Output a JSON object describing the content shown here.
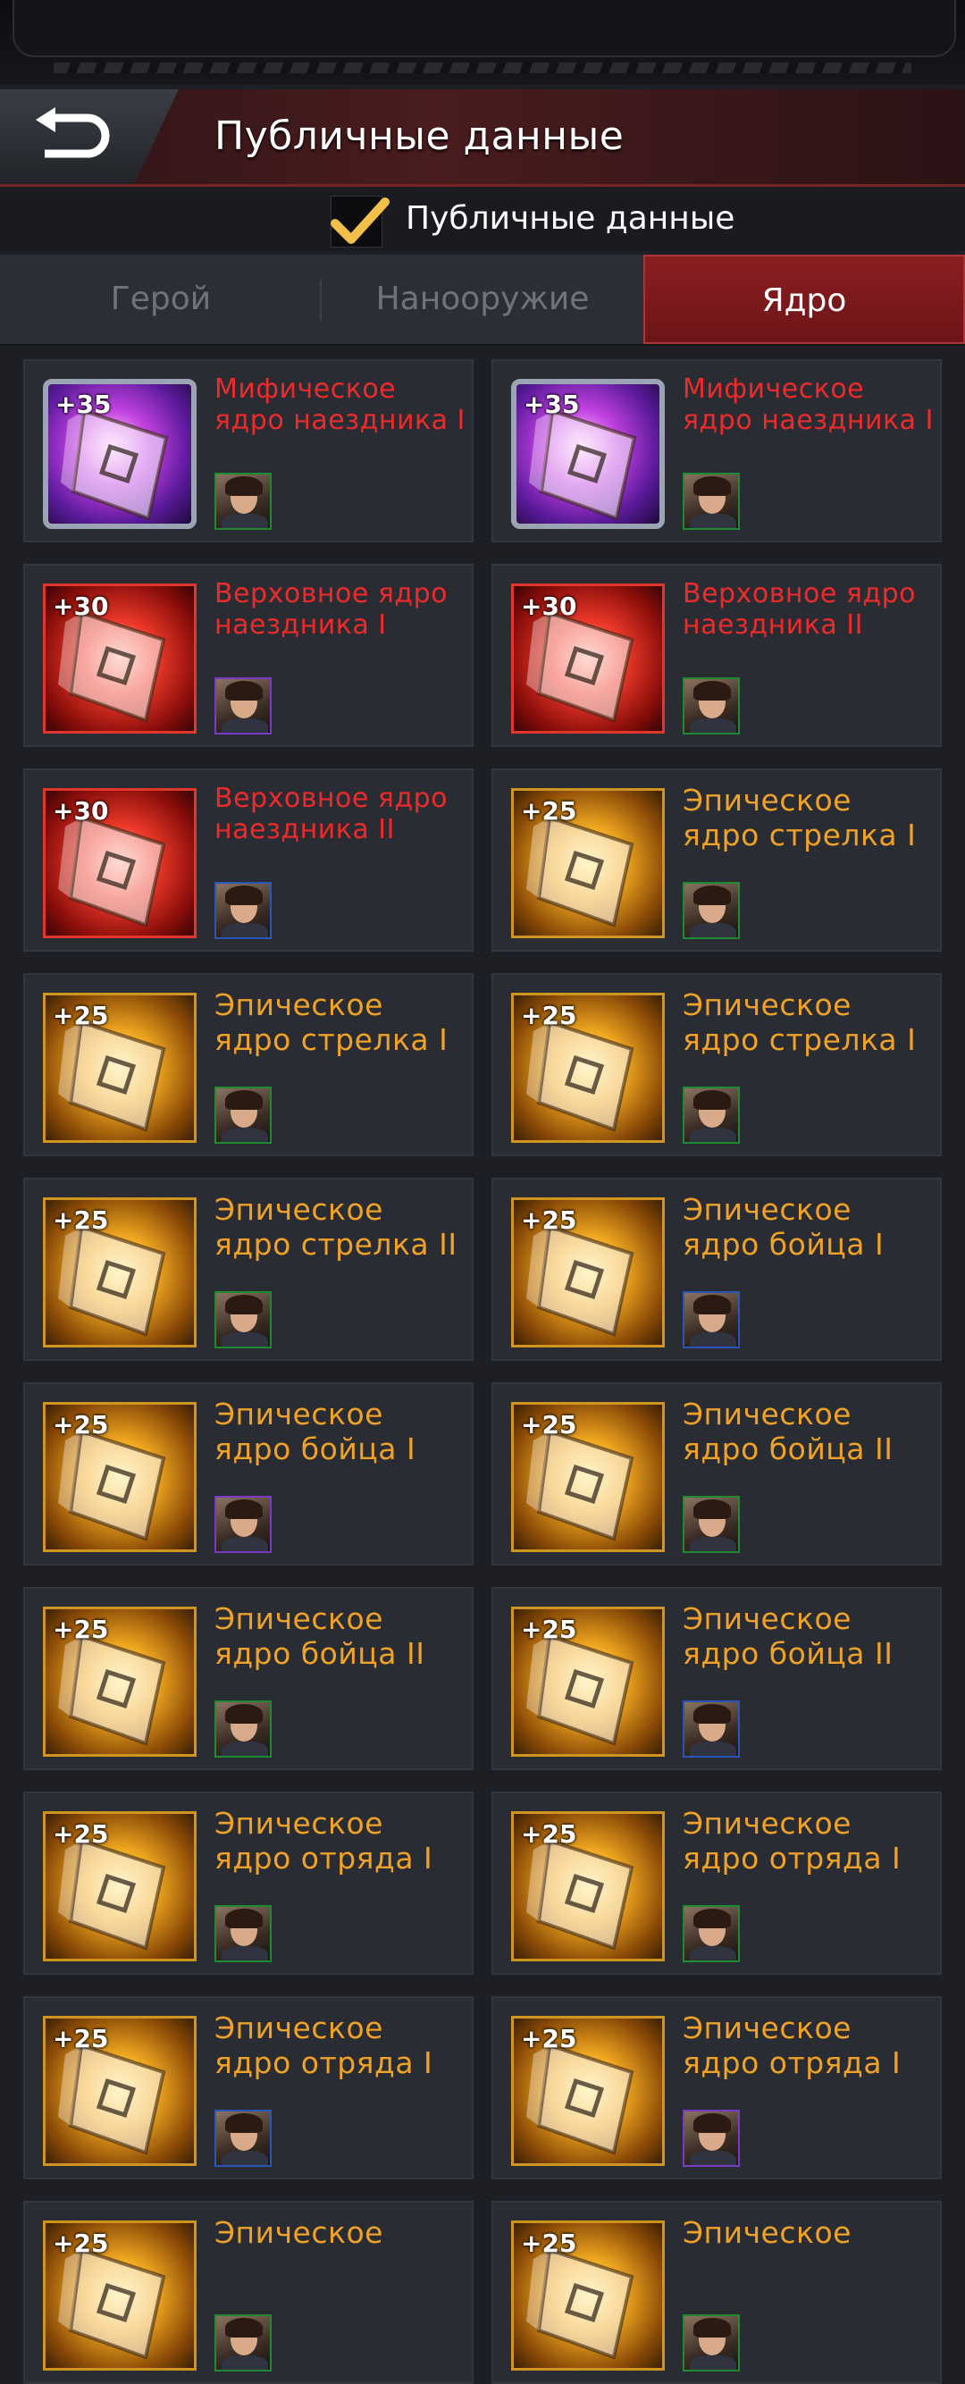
{
  "header": {
    "title": "Публичные данные",
    "back_icon": "back-arrow-icon"
  },
  "public_toggle": {
    "label": "Публичные данные",
    "checked": true
  },
  "tabs": [
    {
      "label": "Герой",
      "active": false
    },
    {
      "label": "Нанооружие",
      "active": false
    },
    {
      "label": "Ядро",
      "active": true
    }
  ],
  "colors": {
    "mythic_text": "#ee2a2a",
    "epic_text": "#efa227",
    "active_tab": "#7a181c"
  },
  "cores": [
    {
      "bonus": "+35",
      "name": "Мифическое ядро наездника I",
      "rarity": "mythic"
    },
    {
      "bonus": "+35",
      "name": "Мифическое ядро наездника I",
      "rarity": "mythic"
    },
    {
      "bonus": "+30",
      "name": "Верховное ядро наездника I",
      "rarity": "supreme"
    },
    {
      "bonus": "+30",
      "name": "Верховное ядро наездника II",
      "rarity": "supreme"
    },
    {
      "bonus": "+30",
      "name": "Верховное ядро наездника II",
      "rarity": "supreme"
    },
    {
      "bonus": "+25",
      "name": "Эпическое ядро стрелка I",
      "rarity": "epic"
    },
    {
      "bonus": "+25",
      "name": "Эпическое ядро стрелка I",
      "rarity": "epic"
    },
    {
      "bonus": "+25",
      "name": "Эпическое ядро стрелка I",
      "rarity": "epic"
    },
    {
      "bonus": "+25",
      "name": "Эпическое ядро стрелка II",
      "rarity": "epic"
    },
    {
      "bonus": "+25",
      "name": "Эпическое ядро бойца I",
      "rarity": "epic"
    },
    {
      "bonus": "+25",
      "name": "Эпическое ядро бойца I",
      "rarity": "epic"
    },
    {
      "bonus": "+25",
      "name": "Эпическое ядро бойца II",
      "rarity": "epic"
    },
    {
      "bonus": "+25",
      "name": "Эпическое ядро бойца II",
      "rarity": "epic"
    },
    {
      "bonus": "+25",
      "name": "Эпическое ядро бойца II",
      "rarity": "epic"
    },
    {
      "bonus": "+25",
      "name": "Эпическое ядро отряда I",
      "rarity": "epic"
    },
    {
      "bonus": "+25",
      "name": "Эпическое ядро отряда I",
      "rarity": "epic"
    },
    {
      "bonus": "+25",
      "name": "Эпическое ядро отряда I",
      "rarity": "epic"
    },
    {
      "bonus": "+25",
      "name": "Эпическое ядро отряда I",
      "rarity": "epic"
    },
    {
      "bonus": "+25",
      "name": "Эпическое",
      "rarity": "epic"
    },
    {
      "bonus": "+25",
      "name": "Эпическое",
      "rarity": "epic"
    }
  ]
}
